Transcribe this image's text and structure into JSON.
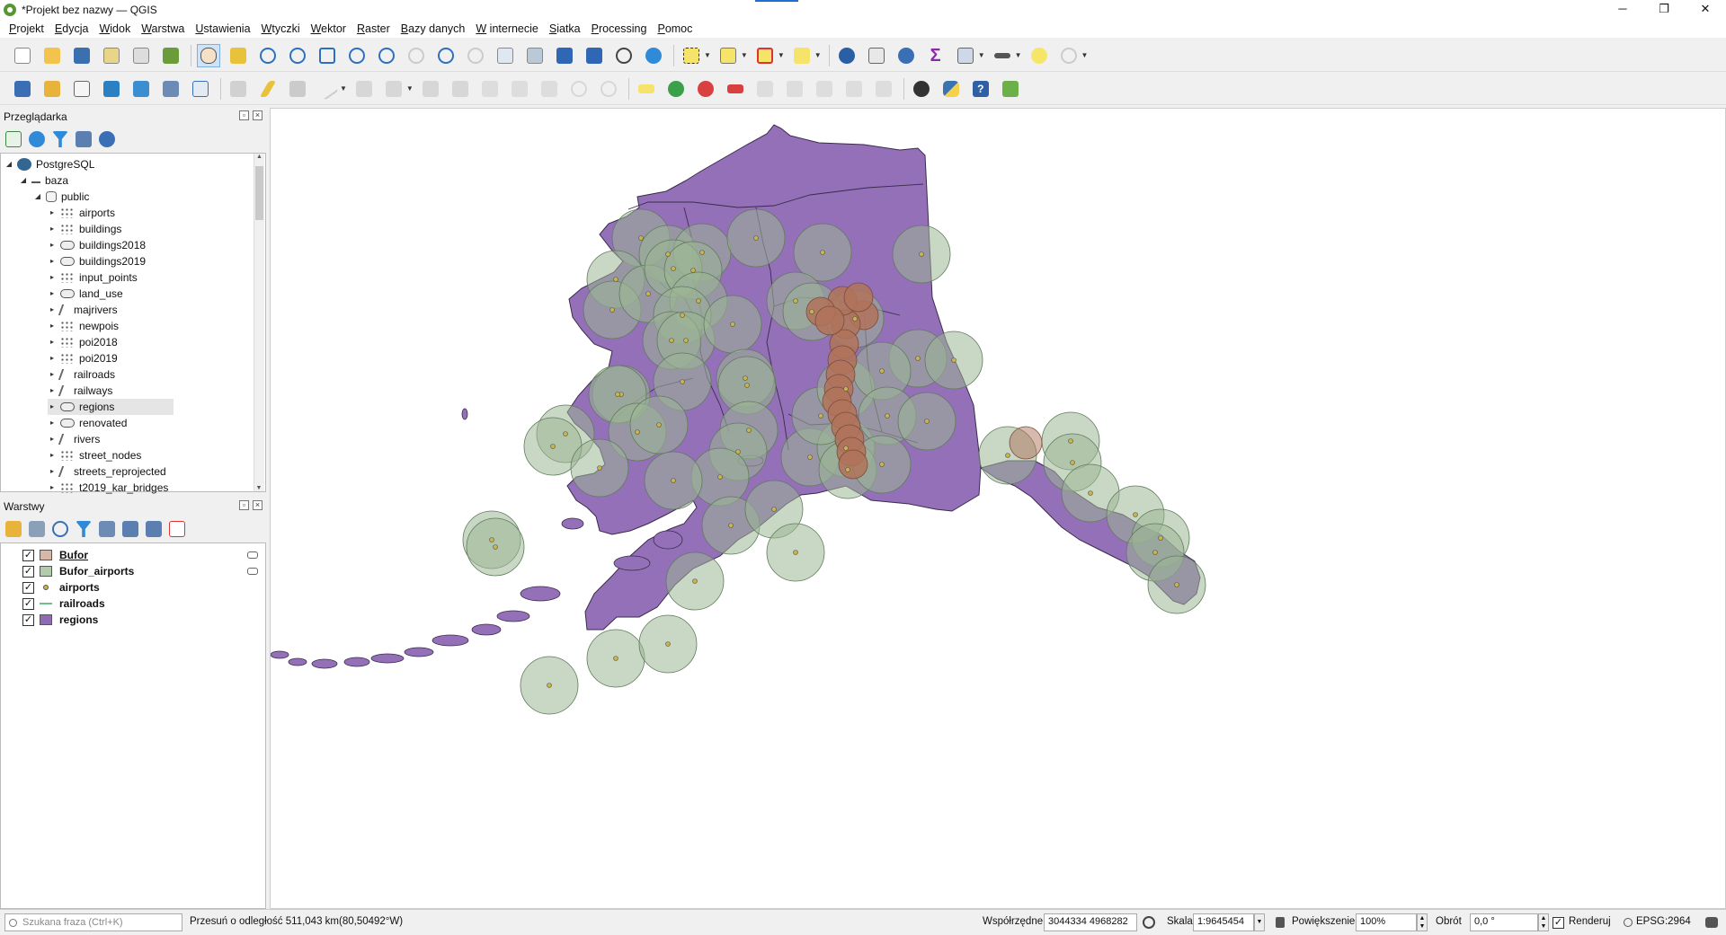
{
  "window": {
    "title": "*Projekt bez nazwy — QGIS",
    "controls": [
      "─",
      "❐",
      "✕"
    ]
  },
  "menu": [
    "Projekt",
    "Edycja",
    "Widok",
    "Warstwa",
    "Ustawienia",
    "Wtyczki",
    "Wektor",
    "Raster",
    "Bazy danych",
    "W internecie",
    "Siatka",
    "Processing",
    "Pomoc"
  ],
  "browser": {
    "title": "Przeglądarka",
    "root": "PostgreSQL",
    "connection": "baza",
    "schema": "public",
    "tables": [
      {
        "name": "airports",
        "type": "pts"
      },
      {
        "name": "buildings",
        "type": "pts"
      },
      {
        "name": "buildings2018",
        "type": "poly"
      },
      {
        "name": "buildings2019",
        "type": "poly"
      },
      {
        "name": "input_points",
        "type": "pts"
      },
      {
        "name": "land_use",
        "type": "poly"
      },
      {
        "name": "majrivers",
        "type": "line"
      },
      {
        "name": "newpois",
        "type": "pts"
      },
      {
        "name": "poi2018",
        "type": "pts"
      },
      {
        "name": "poi2019",
        "type": "pts"
      },
      {
        "name": "railroads",
        "type": "line"
      },
      {
        "name": "railways",
        "type": "line"
      },
      {
        "name": "regions",
        "type": "poly"
      },
      {
        "name": "renovated",
        "type": "poly"
      },
      {
        "name": "rivers",
        "type": "line"
      },
      {
        "name": "street_nodes",
        "type": "pts"
      },
      {
        "name": "streets_reprojected",
        "type": "line"
      },
      {
        "name": "t2019_kar_bridges",
        "type": "pts"
      }
    ]
  },
  "layers": {
    "title": "Warstwy",
    "items": [
      {
        "name": "Bufor",
        "checked": "✓",
        "color": "#d6b7a8",
        "kind": "poly",
        "underline": true
      },
      {
        "name": "Bufor_airports",
        "checked": "✓",
        "color": "#b2ccab",
        "kind": "poly",
        "underline": false
      },
      {
        "name": "airports",
        "checked": "✓",
        "color": "#c8b44a",
        "kind": "point",
        "underline": false
      },
      {
        "name": "railroads",
        "checked": "✓",
        "color": "#6cc08c",
        "kind": "line",
        "underline": false
      },
      {
        "name": "regions",
        "checked": "✓",
        "color": "#8e6bb5",
        "kind": "poly",
        "underline": false
      }
    ]
  },
  "status": {
    "search_placeholder": "Szukana fraza (Ctrl+K)",
    "message": "Przesuń o odległość 511,043 km(80,50492°W)",
    "coord_label": "Współrzędne",
    "coord_value": "3044334  4968282",
    "scale_label": "Skala",
    "scale_value": "1:9645454",
    "zoom_label": "Powiększenie",
    "zoom_value": "100%",
    "rotation_label": "Obrót",
    "rotation_value": "0,0 °",
    "render_label": "Renderuj",
    "crs": "EPSG:2964"
  },
  "colors": {
    "regions_fill": "#9370b8",
    "regions_stroke": "#3b2b4a",
    "buffer_airports": "#9cb796",
    "buffer_rail": "#b0735b",
    "airport_point": "#c8b44a"
  }
}
